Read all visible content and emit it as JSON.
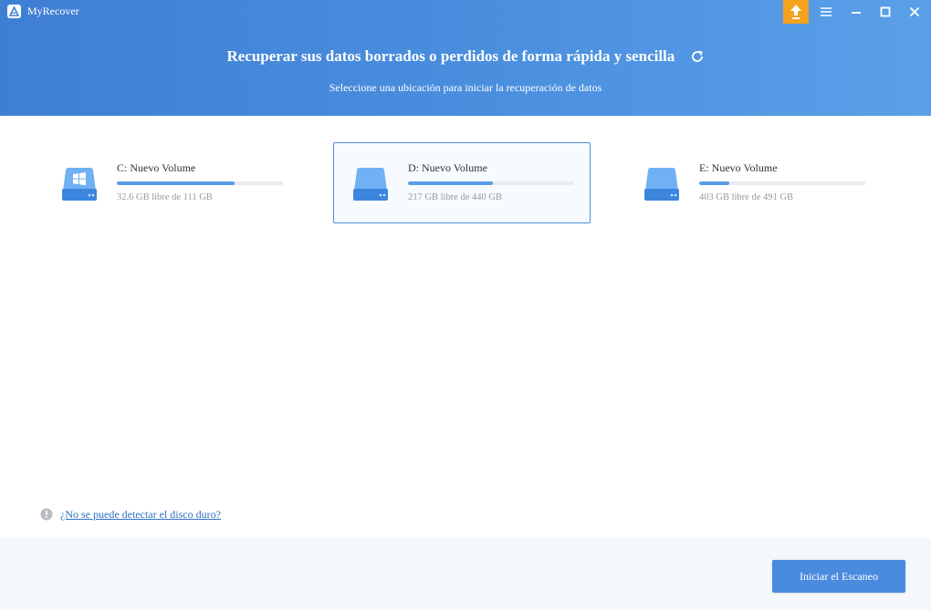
{
  "app": {
    "title": "MyRecover",
    "accent_color": "#4a8be0",
    "upgrade_color": "#f5a21f"
  },
  "window_controls": {
    "icons": [
      "upgrade-icon",
      "menu-icon",
      "minimize-icon",
      "maximize-icon",
      "close-icon"
    ]
  },
  "header": {
    "title": "Recuperar sus datos borrados o perdidos de forma rápida y sencilla",
    "subtitle": "Seleccione una ubicación para iniciar la recuperación de datos",
    "refresh_icon": "refresh-icon"
  },
  "drives": [
    {
      "name": "C: Nuevo Volume",
      "size_text": "32.6 GB libre de 111 GB",
      "used_fraction": 0.71,
      "icon": "windows-drive-icon",
      "selected": false
    },
    {
      "name": "D: Nuevo Volume",
      "size_text": "217 GB libre de 440 GB",
      "used_fraction": 0.51,
      "icon": "drive-icon",
      "selected": true
    },
    {
      "name": "E: Nuevo Volume",
      "size_text": "403 GB libre de 491 GB",
      "used_fraction": 0.18,
      "icon": "drive-icon",
      "selected": false
    }
  ],
  "help": {
    "link_text": "¿No se puede detectar el disco duro?",
    "icon": "info-icon"
  },
  "footer": {
    "scan_button_label": "Iniciar el Escaneo"
  }
}
